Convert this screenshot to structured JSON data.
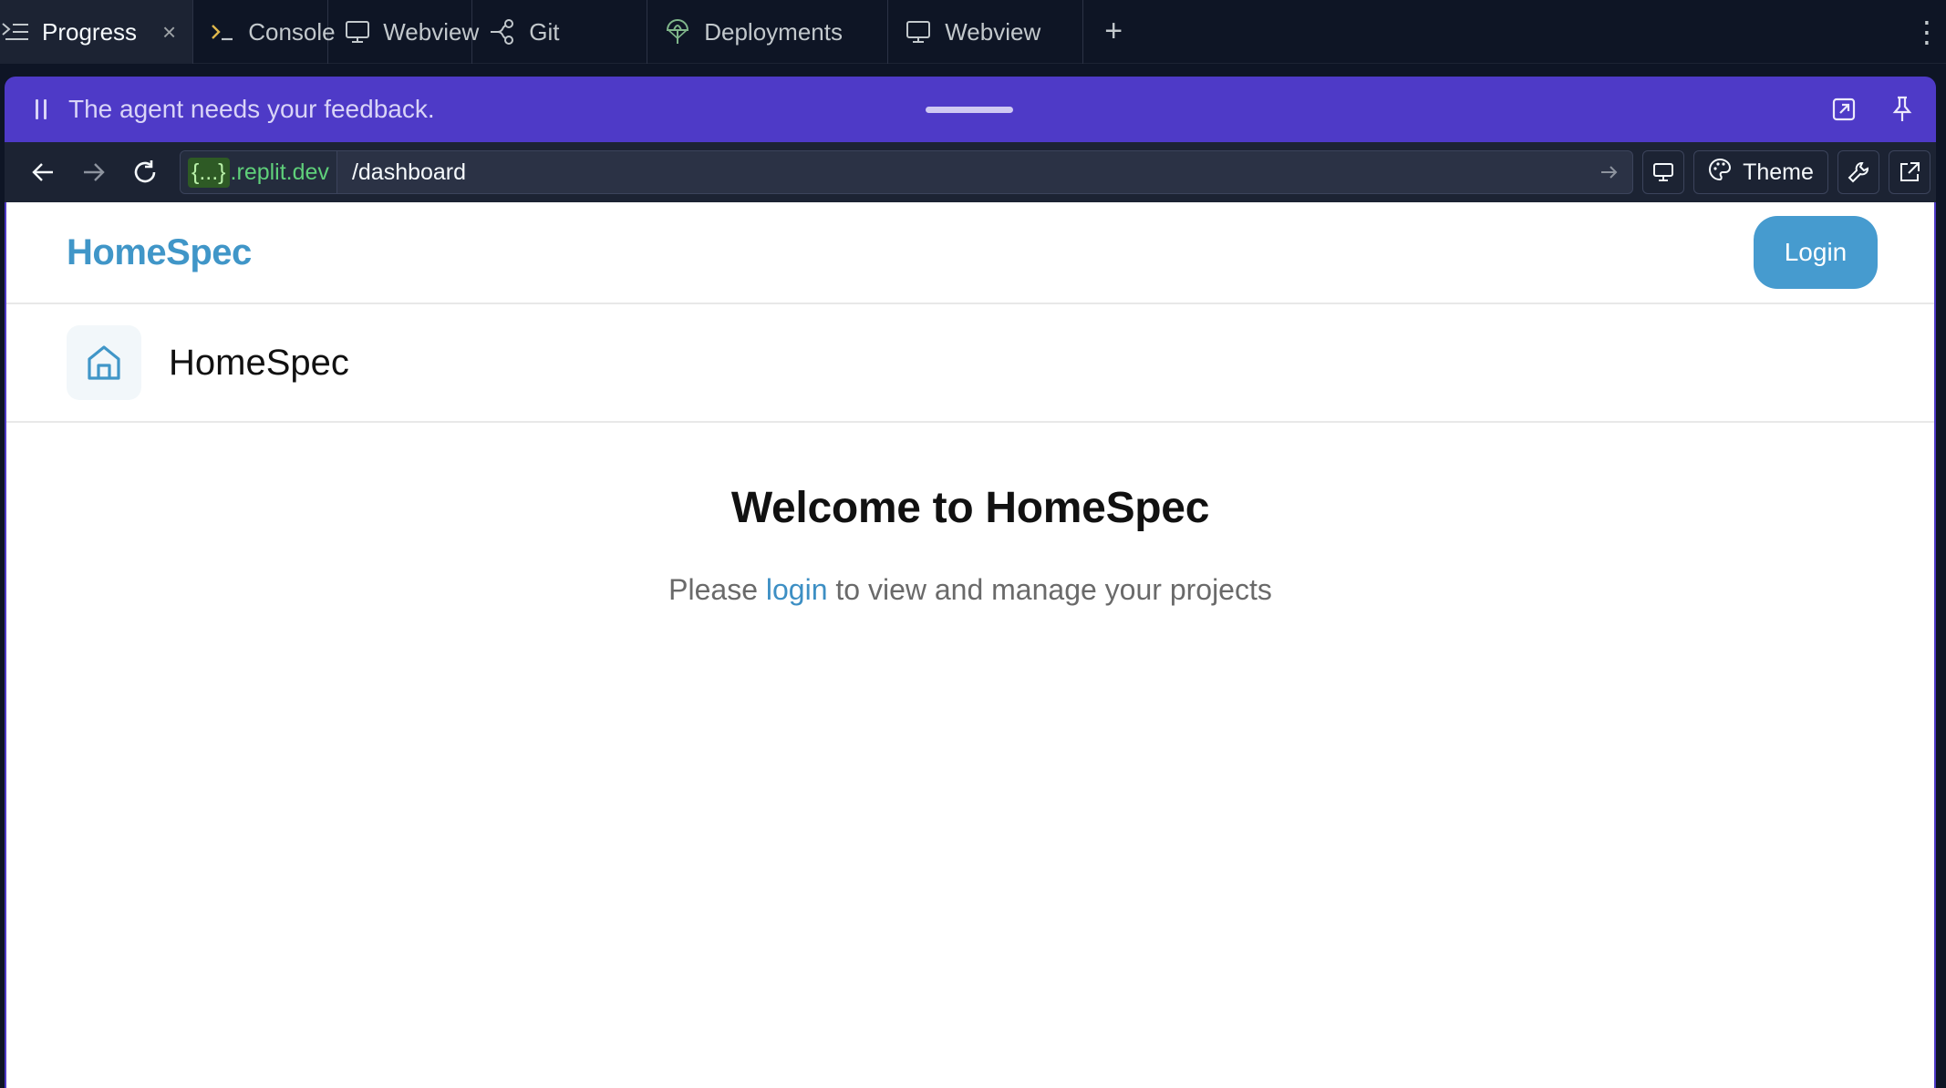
{
  "tabs": [
    {
      "label": "Progress",
      "icon": "progress-icon",
      "active": true,
      "closable": true
    },
    {
      "label": "Console",
      "icon": "console-icon"
    },
    {
      "label": "Webview",
      "icon": "monitor-icon"
    },
    {
      "label": "Git",
      "icon": "git-icon"
    },
    {
      "label": "Deployments",
      "icon": "deployments-icon"
    },
    {
      "label": "Webview",
      "icon": "monitor-icon"
    }
  ],
  "tab_add_label": "+",
  "tab_close_label": "×",
  "more_menu_label": "⋮",
  "feedback": {
    "message": "The agent needs your feedback."
  },
  "browser": {
    "domain_mask": "{...}",
    "domain_suffix": ".replit.dev",
    "path": "/dashboard",
    "theme_label": "Theme"
  },
  "app": {
    "brand": "HomeSpec",
    "login_button": "Login",
    "sub_title": "HomeSpec",
    "welcome_title": "Welcome to HomeSpec",
    "tagline_before": "Please ",
    "tagline_link": "login",
    "tagline_after": " to view and manage your projects"
  },
  "colors": {
    "panel_accent": "#4e3ac7",
    "brand_blue": "#4096c8",
    "domain_green": "#5fd07a"
  }
}
